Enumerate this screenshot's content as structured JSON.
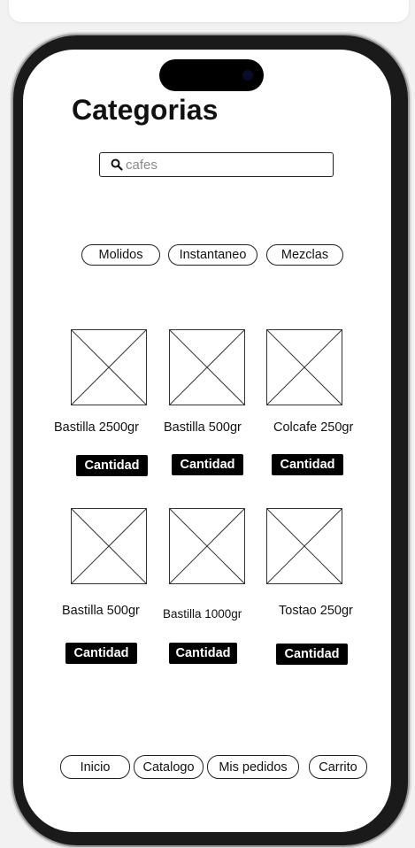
{
  "page": {
    "title": "Categorias"
  },
  "search": {
    "placeholder": "cafes",
    "icon": "search-icon"
  },
  "categories": [
    "Molidos",
    "Instantaneo",
    "Mezclas"
  ],
  "products": [
    {
      "name": "Bastilla 2500gr",
      "button": "Cantidad"
    },
    {
      "name": "Bastilla 500gr",
      "button": "Cantidad"
    },
    {
      "name": "Colcafe 250gr",
      "button": "Cantidad"
    },
    {
      "name": "Bastilla 500gr",
      "button": "Cantidad"
    },
    {
      "name": "Bastilla 1000gr",
      "button": "Cantidad"
    },
    {
      "name": "Tostao 250gr",
      "button": "Cantidad"
    }
  ],
  "bottom_nav": [
    "Inicio",
    "Catalogo",
    "Mis pedidos",
    "Carrito"
  ],
  "colors": {
    "button_bg": "#000000",
    "button_text": "#ffffff",
    "frame": "#1a1a1a"
  }
}
